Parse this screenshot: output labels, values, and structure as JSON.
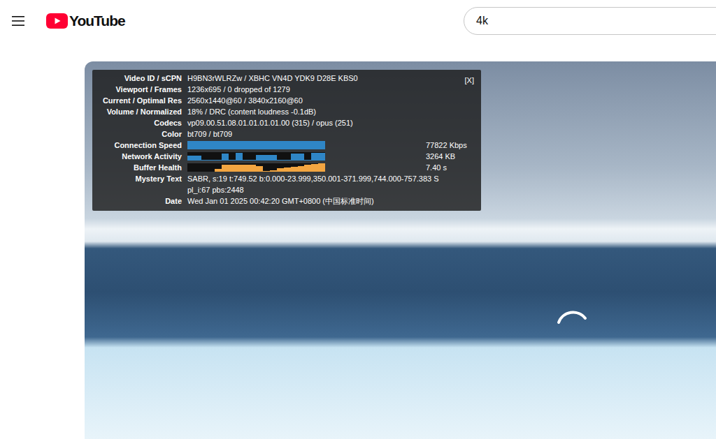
{
  "masthead": {
    "logo": "YouTube"
  },
  "search": {
    "value": "4k"
  },
  "stats": {
    "close": "[X]",
    "rows": [
      {
        "kind": "text",
        "label": "Video ID / sCPN",
        "lines": [
          "H9BN3rWLRZw / XBHC VN4D YDK9 D28E KBS0"
        ]
      },
      {
        "kind": "text",
        "label": "Viewport / Frames",
        "lines": [
          "1236x695 / 0 dropped of 1279"
        ]
      },
      {
        "kind": "text",
        "label": "Current / Optimal Res",
        "lines": [
          "2560x1440@60 / 3840x2160@60"
        ]
      },
      {
        "kind": "text",
        "label": "Volume / Normalized",
        "lines": [
          "18% / DRC (content loudness -0.1dB)"
        ]
      },
      {
        "kind": "text",
        "label": "Codecs",
        "lines": [
          "vp09.00.51.08.01.01.01.01.00 (315) / opus (251)"
        ]
      },
      {
        "kind": "text",
        "label": "Color",
        "lines": [
          "bt709 / bt709"
        ]
      },
      {
        "kind": "graph",
        "label": "Connection Speed",
        "color": "#2f86c6",
        "reading": "77822 Kbps",
        "values": [
          1,
          1,
          1,
          1,
          1,
          1,
          1,
          1,
          1,
          1,
          1,
          1,
          1,
          1,
          1,
          1,
          1,
          1,
          1,
          1
        ]
      },
      {
        "kind": "graph",
        "label": "Network Activity",
        "color": "#2f86c6",
        "reading": "3264 KB",
        "values": [
          0.6,
          0.6,
          0.1,
          0.1,
          0.1,
          0.8,
          0.1,
          0.9,
          0.1,
          0.1,
          0.7,
          0.7,
          0.7,
          0.1,
          0.1,
          0.8,
          0.8,
          0.1,
          0.9,
          0.9
        ]
      },
      {
        "kind": "graph",
        "label": "Buffer Health",
        "color": "#f2a541",
        "reading": "7.40 s",
        "values": [
          0,
          0,
          0,
          0,
          0.3,
          0.8,
          0.8,
          0.8,
          0.8,
          0.8,
          0.7,
          0.1,
          0.2,
          0.4,
          0.5,
          0.6,
          0.7,
          0.8,
          0.9,
          1
        ]
      },
      {
        "kind": "text",
        "label": "Mystery Text",
        "lines": [
          "SABR, s:19 t:749.52 b:0.000-23.999,350.001-371.999,744.000-757.383 S",
          "pl_i:67 pbs:2448"
        ]
      },
      {
        "kind": "text",
        "label": "Date",
        "lines": [
          "Wed Jan 01 2025 00:42:20 GMT+0800 (中国标准时间)"
        ]
      }
    ]
  }
}
